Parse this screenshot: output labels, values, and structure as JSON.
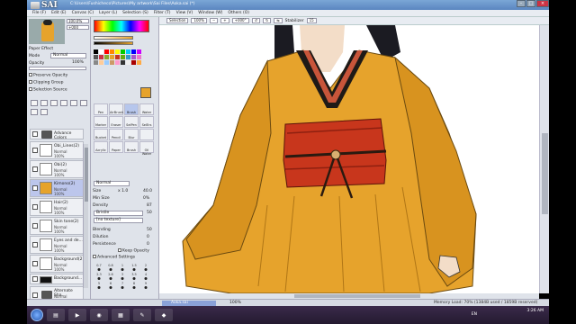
{
  "app": {
    "logo_text": "SAI",
    "title_path": "C:\\Users\\Fushicheco\\Pictures\\My artwork\\Sai Files\\Aoka.sai (*)"
  },
  "menu": [
    "File (F)",
    "Edit (E)",
    "Canvas (C)",
    "Layer (L)",
    "Selection (S)",
    "Filter (T)",
    "View (V)",
    "Window (W)",
    "Others (O)"
  ],
  "toolbar": {
    "selection_label": "Selection",
    "zoom": "100%",
    "rotation": "+000°",
    "stabilizer_label": "Stabilizer",
    "stabilizer_value": "15"
  },
  "navigator": {
    "zoom": "100.0%",
    "angle": "+000"
  },
  "layer_panel": {
    "mode_label": "Mode",
    "mode_value": "Normal",
    "opacity_label": "Opacity",
    "opacity_value": "100%",
    "paper_effect": "Paper Effect",
    "options": [
      "Preserve Opacity",
      "Clipping Group",
      "Selection Source"
    ]
  },
  "layers": [
    {
      "name": "Advance Colors",
      "mode": "",
      "opacity": "",
      "folder": true
    },
    {
      "name": "Obi_Lines(2)",
      "mode": "Normal",
      "opacity": "100%"
    },
    {
      "name": "Obi(2)",
      "mode": "Normal",
      "opacity": "100%"
    },
    {
      "name": "Kimono(2)",
      "mode": "Normal",
      "opacity": "100%",
      "selected": true
    },
    {
      "name": "Hair(2)",
      "mode": "Normal",
      "opacity": "100%"
    },
    {
      "name": "Skin tone(2)",
      "mode": "Normal",
      "opacity": "100%"
    },
    {
      "name": "Eyes and de...",
      "mode": "Normal",
      "opacity": "100%"
    },
    {
      "name": "Background(2)",
      "mode": "Normal",
      "opacity": "100%"
    },
    {
      "name": "Background...",
      "mode": "",
      "opacity": ""
    },
    {
      "name": "Alternate Sha...",
      "mode": "Normal",
      "opacity": "100%",
      "folder": true
    },
    {
      "name": "Parts",
      "mode": "Normal",
      "opacity": "100%",
      "folder": true
    }
  ],
  "tools": [
    "Pen",
    "AirBrush",
    "Brush",
    "Water",
    "Marker",
    "Eraser",
    "SelPen",
    "SelErs",
    "Bucket",
    "Pencil",
    "Blur",
    "",
    "Acrylic",
    "Paper",
    "Brush",
    "Oil Water"
  ],
  "brush_settings": {
    "mode": "Normal",
    "size_label": "Size",
    "size_mult": "x 1.0",
    "size_value": "40.0",
    "min_size_label": "Min Size",
    "min_size_value": "0%",
    "density_label": "Density",
    "density_value": "87",
    "texture1": "Bristle",
    "texture1_value": "50",
    "texture2": "[no texture]",
    "blending_label": "Blending",
    "blending_value": "50",
    "dilution_label": "Dilution",
    "dilution_value": "0",
    "persistence_label": "Persistence",
    "persistence_value": "0",
    "keep_opacity": "Keep Opacity",
    "advanced": "Advanced Settings"
  },
  "brush_sizes": [
    "0.7",
    "0.8",
    "1",
    "1.5",
    "2",
    "2.3",
    "2.6",
    "3",
    "3.5",
    "4",
    "5",
    "6",
    "7",
    "8",
    "9"
  ],
  "status": {
    "tab_name": "Aoka.sai",
    "tab_zoom": "100%",
    "memory": "Memory Load: 70% (1384B used / 1859B reserved)"
  },
  "taskbar": {
    "lang": "EN",
    "time": "3:26 AM"
  },
  "colors": {
    "kimono": "#e6a32c",
    "obi": "#c8361c",
    "collar": "#1f1a17",
    "accent": "#7aa6d6"
  }
}
